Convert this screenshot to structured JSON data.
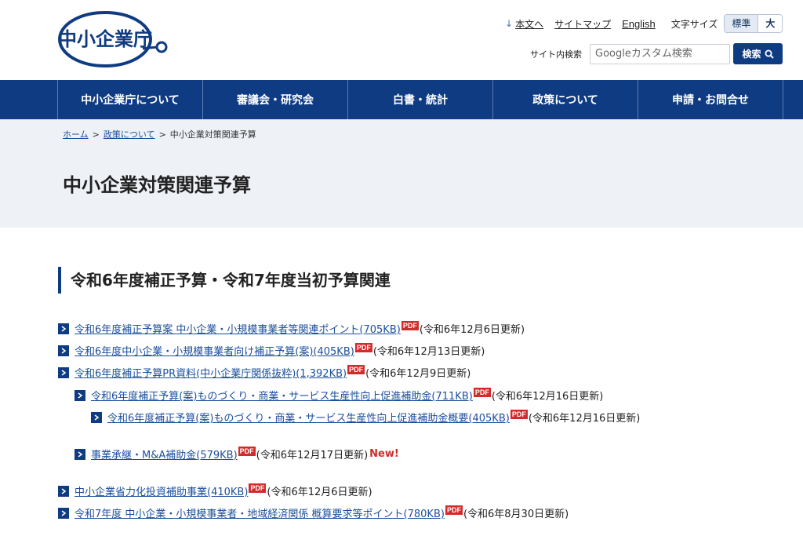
{
  "header": {
    "logo_text": "中小企業庁",
    "util_links": [
      {
        "label": "本文へ",
        "icon": "arrow-down-icon"
      },
      {
        "label": "サイトマップ"
      },
      {
        "label": "English"
      }
    ],
    "font_size_label": "文字サイズ",
    "font_size_options": [
      "標準",
      "大"
    ],
    "search_label": "サイト内検索",
    "search_placeholder": "Googleカスタム検索",
    "search_button": "検索"
  },
  "nav": {
    "items": [
      "中小企業庁について",
      "審議会・研究会",
      "白書・統計",
      "政策について",
      "申請・お問合せ"
    ]
  },
  "breadcrumb": {
    "items": [
      "ホーム",
      "政策について"
    ],
    "current": "中小企業対策関連予算"
  },
  "page_title": "中小企業対策関連予算",
  "section_heading": "令和6年度補正予算・令和7年度当初予算関連",
  "pdf_badge": "PDF",
  "items": [
    {
      "text": "令和6年度補正予算案 中小企業・小規模事業者等関連ポイント(705KB)",
      "update": "(令和6年12月6日更新)"
    },
    {
      "text": "令和6年度中小企業・小規模事業者向け補正予算(案)(405KB)",
      "update": "(令和6年12月13日更新)"
    },
    {
      "text": "令和6年度補正予算PR資料(中小企業庁関係抜粋)(1,392KB)",
      "update": "(令和6年12月9日更新)"
    },
    {
      "text": "令和6年度補正予算(案)ものづくり・商業・サービス生産性向上促進補助金(711KB)",
      "update": "(令和6年12月16日更新)"
    },
    {
      "text": "令和6年度補正予算(案)ものづくり・商業・サービス生産性向上促進補助金概要(405KB)",
      "update": "(令和6年12月16日更新)"
    },
    {
      "text": "事業承継・M&A補助金(579KB)",
      "update": "(令和6年12月17日更新)",
      "new": "New!"
    },
    {
      "text": "中小企業省力化投資補助事業(410KB)",
      "update": "(令和6年12月6日更新)"
    },
    {
      "text": "令和7年度 中小企業・小規模事業者・地域経済関係 概算要求等ポイント(780KB)",
      "update": "(令和6年8月30日更新)"
    }
  ],
  "colors": {
    "brand_navy": "#0f3b82",
    "link_blue": "#1c4f9c",
    "pdf_red": "#d32a2a",
    "title_bg": "#eef1f6"
  }
}
